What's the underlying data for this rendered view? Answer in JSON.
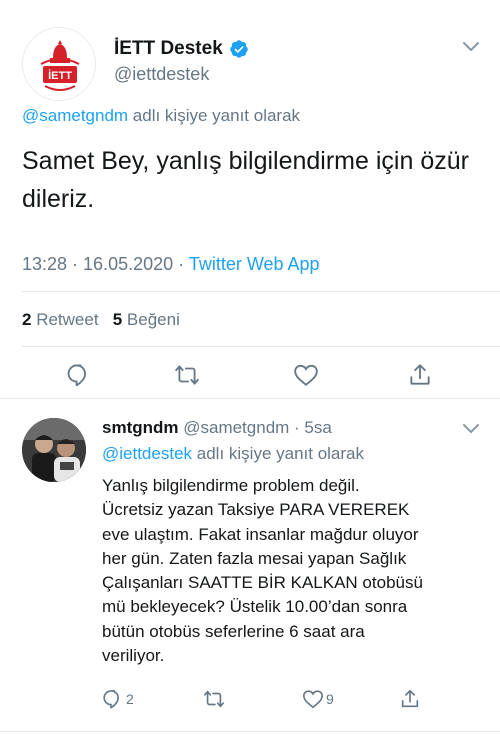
{
  "main_tweet": {
    "author_name": "İETT Destek",
    "author_handle": "@iettdestek",
    "logo_text": "İETT",
    "reply_to_mention": "@sametgndm",
    "reply_to_suffix": " adlı kişiye yanıt olarak",
    "text": "Samet Bey, yanlış bilgilendirme için özür dileriz.",
    "time": "13:28 · 16.05.2020 · ",
    "source": "Twitter Web App",
    "retweet_count": "2",
    "retweet_label": " Retweet",
    "like_count": "5",
    "like_label": " Beğeni"
  },
  "reply_tweet": {
    "author_name": "smtgndm",
    "author_handle": "@sametgndm",
    "time_ago": " · 5sa",
    "reply_to_mention": "@iettdestek",
    "reply_to_suffix": " adlı kişiye yanıt olarak",
    "text": "Yanlış bilgilendirme problem değil.\nÜcretsiz yazan Taksiye PARA VEREREK\neve ulaştım. Fakat insanlar mağdur oluyor\nher gün. Zaten fazla mesai yapan Sağlık\nÇalışanları SAATTE BİR KALKAN otobüsü\nmü bekleyecek? Üstelik 10.00’dan sonra\nbütün otobüs seferlerine 6 saat ara\nveriliyor.",
    "reply_count": "2",
    "like_count": "9"
  },
  "colors": {
    "accent": "#1da1f2",
    "muted": "#657786",
    "text": "#14171a",
    "logo_red": "#d6202a"
  },
  "icons": [
    "verified-badge-icon",
    "chevron-down-icon",
    "reply-icon",
    "retweet-icon",
    "like-icon",
    "share-icon"
  ]
}
